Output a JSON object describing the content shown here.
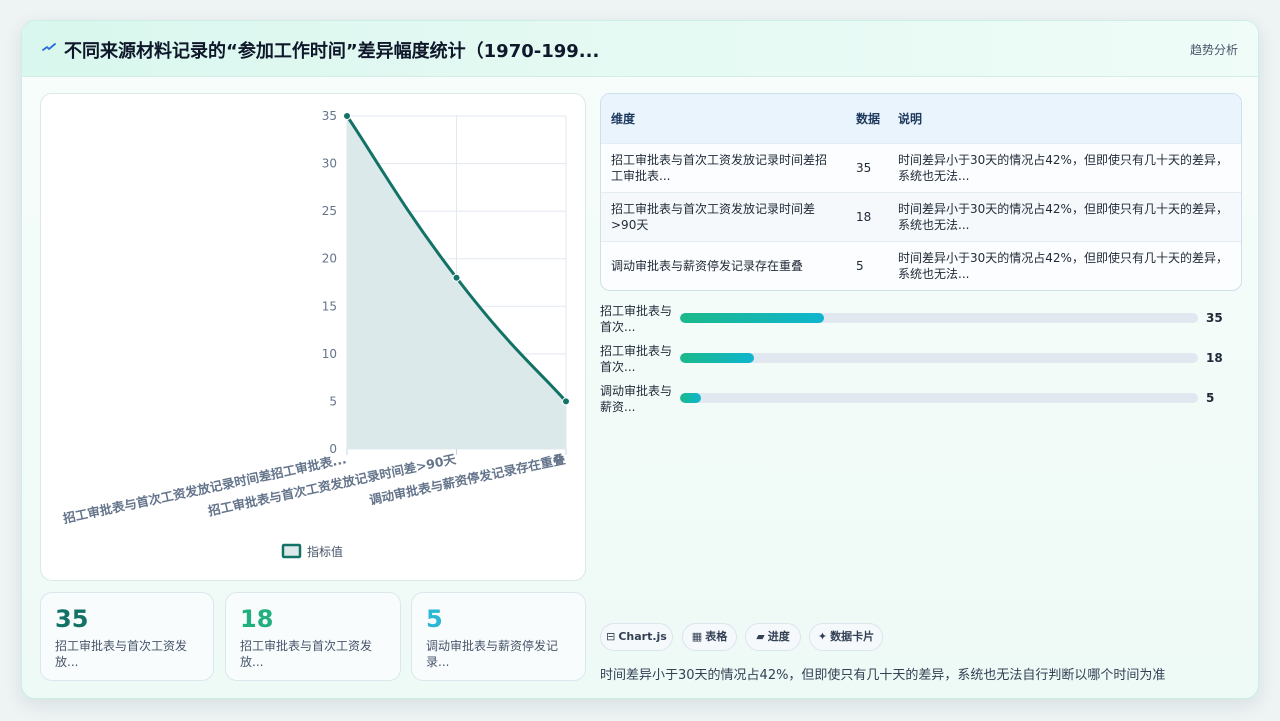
{
  "header": {
    "title": "不同来源材料记录的“参加工作时间”差异幅度统计（1970-199...",
    "trend_label": "趋势分析",
    "title_icon": "pulse-line-icon"
  },
  "chart_data": {
    "type": "area",
    "categories": [
      "招工审批表与首次工资发放记录时间差招工审批表...",
      "招工审批表与首次工资发放记录时间差>90天",
      "调动审批表与薪资停发记录存在重叠"
    ],
    "series": [
      {
        "name": "指标值",
        "values": [
          35,
          18,
          5
        ]
      }
    ],
    "y_ticks": [
      "0",
      "5",
      "10",
      "15",
      "20",
      "25",
      "30",
      "35"
    ],
    "ylim": [
      0,
      35
    ],
    "grid": true,
    "legend_position": "bottom",
    "colors": {
      "line": "#127266",
      "fill": "#dce9ea",
      "grid": "#e2e8f0"
    }
  },
  "stats": [
    {
      "value": "35",
      "label": "招工审批表与首次工资发放...",
      "color": "#127266"
    },
    {
      "value": "18",
      "label": "招工审批表与首次工资发放...",
      "color": "#21b07d"
    },
    {
      "value": "5",
      "label": "调动审批表与薪资停发记录...",
      "color": "#2ab8d6"
    }
  ],
  "table": {
    "headers": [
      "维度",
      "数据",
      "说明"
    ],
    "rows": [
      [
        "招工审批表与首次工资发放记录时间差招工审批表...",
        "35",
        "时间差异小于30天的情况占42%，但即使只有几十天的差异，系统也无法..."
      ],
      [
        "招工审批表与首次工资发放记录时间差>90天",
        "18",
        "时间差异小于30天的情况占42%，但即使只有几十天的差异，系统也无法..."
      ],
      [
        "调动审批表与薪资停发记录存在重叠",
        "5",
        "时间差异小于30天的情况占42%，但即使只有几十天的差异，系统也无法..."
      ]
    ]
  },
  "progress": {
    "max": 126,
    "items": [
      {
        "label": "招工审批表与首次...",
        "value": 35
      },
      {
        "label": "招工审批表与首次...",
        "value": 18
      },
      {
        "label": "调动审批表与薪资...",
        "value": 5
      }
    ]
  },
  "chips": [
    {
      "icon": "⊟",
      "icon_name": "chart-icon",
      "label": "Chart.js"
    },
    {
      "icon": "▦",
      "icon_name": "table-icon",
      "label": "表格"
    },
    {
      "icon": "▰",
      "icon_name": "progress-icon",
      "label": "进度"
    },
    {
      "icon": "✦",
      "icon_name": "sparkle-icon",
      "label": "数据卡片"
    }
  ],
  "note": "时间差异小于30天的情况占42%，但即使只有几十天的差异，系统也无法自行判断以哪个时间为准"
}
